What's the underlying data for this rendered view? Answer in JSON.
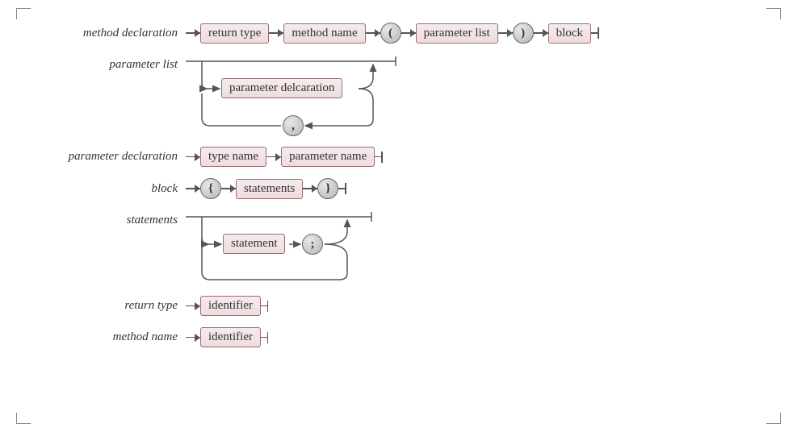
{
  "rules": {
    "method_declaration": {
      "label": "method declaration",
      "items": [
        "return type",
        "method name",
        "(",
        "parameter list",
        ")",
        "block"
      ]
    },
    "parameter_list": {
      "label": "parameter list",
      "loop_item": "parameter delcaration",
      "separator": ","
    },
    "parameter_declaration": {
      "label": "parameter declaration",
      "items": [
        "type name",
        "parameter name"
      ]
    },
    "block": {
      "label": "block",
      "items": [
        "{",
        "statements",
        "}"
      ]
    },
    "statements": {
      "label": "statements",
      "loop_item": "statement",
      "separator": ";"
    },
    "return_type": {
      "label": "return type",
      "items": [
        "identifier"
      ]
    },
    "method_name": {
      "label": "method name",
      "items": [
        "identifier"
      ]
    }
  }
}
